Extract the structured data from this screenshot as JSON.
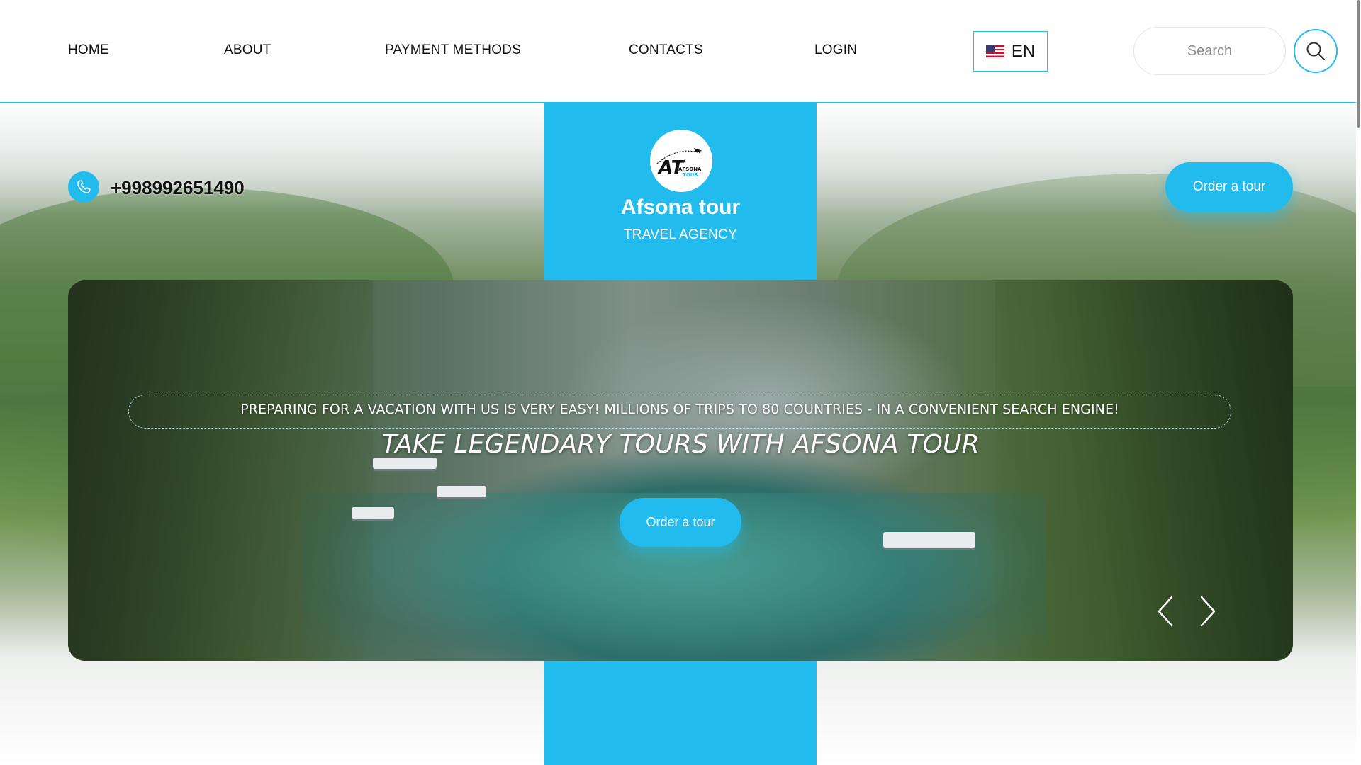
{
  "nav": {
    "items": [
      {
        "label": "HOME"
      },
      {
        "label": "ABOUT"
      },
      {
        "label": "PAYMENT METHODS"
      },
      {
        "label": "CONTACTS"
      },
      {
        "label": "LOGIN"
      }
    ],
    "language": {
      "label": "EN",
      "icon": "us-flag-icon"
    },
    "search": {
      "placeholder": "Search",
      "icon": "search-icon"
    }
  },
  "brand": {
    "name": "Afsona tour",
    "subtitle": "TRAVEL AGENCY",
    "logo_text": "AT",
    "logo_small": "AFSONA",
    "logo_small2": "TOUR"
  },
  "contact": {
    "phone": "+998992651490",
    "icon": "phone-icon"
  },
  "header_cta": {
    "label": "Order a tour"
  },
  "slider": {
    "tagline": "PREPARING FOR A VACATION WITH US IS VERY EASY! MILLIONS OF TRIPS TO 80 COUNTRIES - IN A CONVENIENT SEARCH ENGINE!",
    "headline": "TAKE LEGENDARY TOURS WITH AFSONA TOUR",
    "cta": "Order a tour",
    "prev_icon": "chevron-left-icon",
    "next_icon": "chevron-right-icon"
  },
  "colors": {
    "accent": "#22bbee",
    "text": "#111111",
    "white": "#ffffff"
  }
}
